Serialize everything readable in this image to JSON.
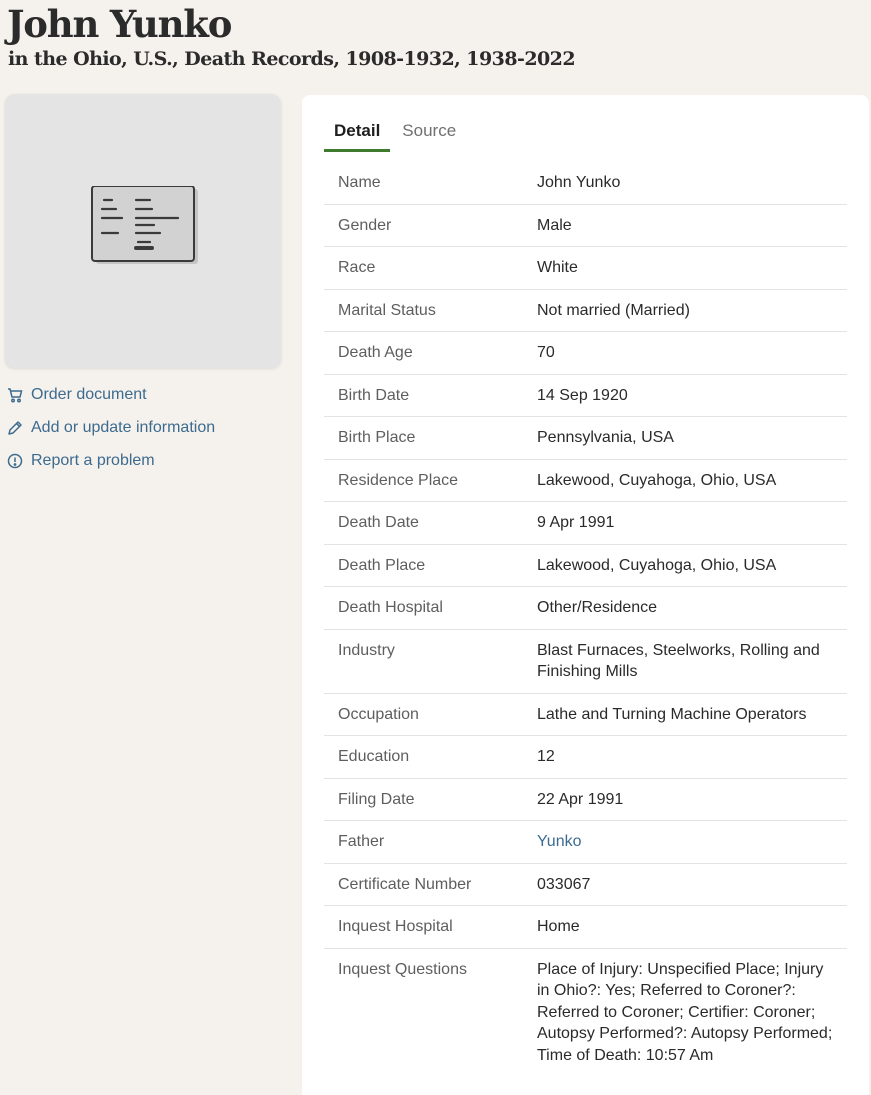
{
  "header": {
    "name": "John Yunko",
    "collection": "in the Ohio, U.S., Death Records, 1908-1932, 1938-2022"
  },
  "thumbnail": {
    "icon": "document-card-icon"
  },
  "actions": [
    {
      "label": "Order document",
      "icon": "cart-icon"
    },
    {
      "label": "Add or update information",
      "icon": "pencil-icon"
    },
    {
      "label": "Report a problem",
      "icon": "alert-circle-icon"
    }
  ],
  "tabs": [
    {
      "label": "Detail",
      "active": true
    },
    {
      "label": "Source",
      "active": false
    }
  ],
  "colors": {
    "accent_tab": "#3f7b2f",
    "link": "#3d6b8f",
    "page_bg": "#f5f1ec"
  },
  "records": [
    {
      "label": "Name",
      "value": "John Yunko"
    },
    {
      "label": "Gender",
      "value": "Male"
    },
    {
      "label": "Race",
      "value": "White"
    },
    {
      "label": "Marital Status",
      "value": "Not married (Married)"
    },
    {
      "label": "Death Age",
      "value": "70"
    },
    {
      "label": "Birth Date",
      "value": "14 Sep 1920"
    },
    {
      "label": "Birth Place",
      "value": "Pennsylvania, USA"
    },
    {
      "label": "Residence Place",
      "value": "Lakewood, Cuyahoga, Ohio, USA"
    },
    {
      "label": "Death Date",
      "value": "9 Apr 1991"
    },
    {
      "label": "Death Place",
      "value": "Lakewood, Cuyahoga, Ohio, USA"
    },
    {
      "label": "Death Hospital",
      "value": "Other/Residence"
    },
    {
      "label": "Industry",
      "value": "Blast Furnaces, Steelworks, Rolling and Finishing Mills"
    },
    {
      "label": "Occupation",
      "value": "Lathe and Turning Machine Operators"
    },
    {
      "label": "Education",
      "value": "12"
    },
    {
      "label": "Filing Date",
      "value": "22 Apr 1991"
    },
    {
      "label": "Father",
      "value": "Yunko",
      "link": true
    },
    {
      "label": "Certificate Number",
      "value": "033067"
    },
    {
      "label": "Inquest Hospital",
      "value": "Home"
    },
    {
      "label": "Inquest Questions",
      "value": "Place of Injury: Unspecified Place; Injury in Ohio?: Yes; Referred to Coroner?: Referred to Coroner; Certifier: Coroner; Autopsy Performed?: Autopsy Performed; Time of Death: 10:57 Am"
    }
  ]
}
